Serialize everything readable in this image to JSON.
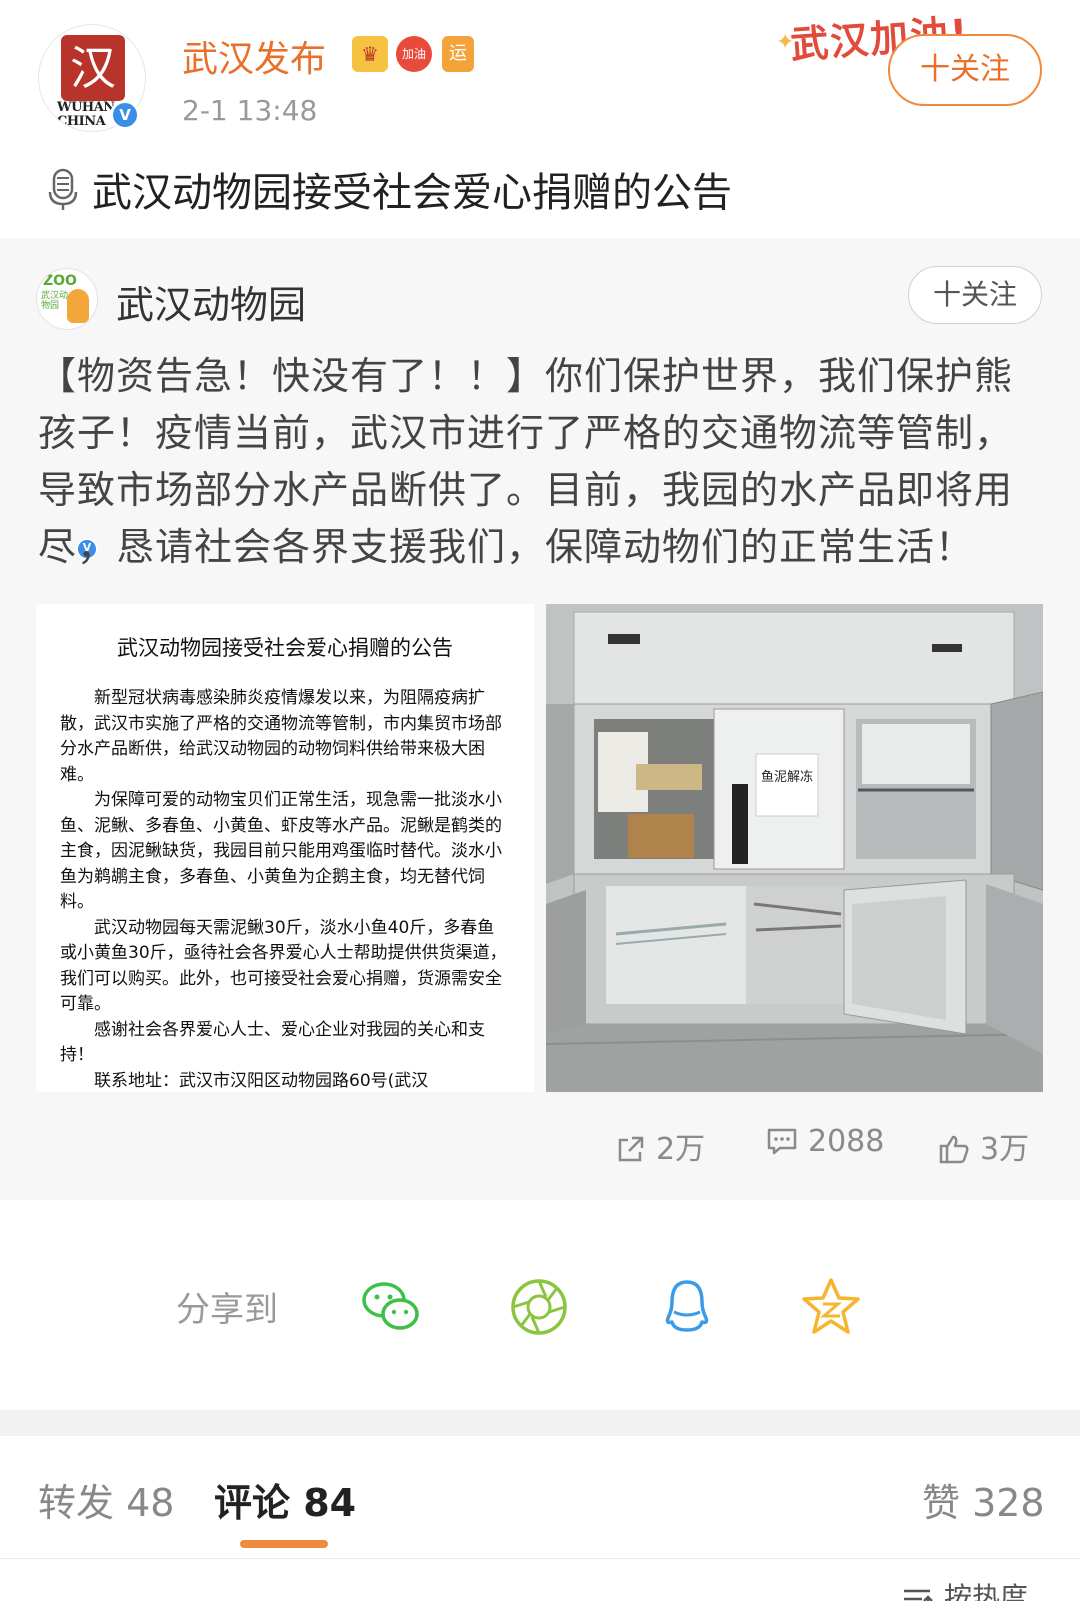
{
  "author": {
    "name": "武汉发布",
    "time": "2-1 13:48",
    "avatar_text": "汉",
    "avatar_en": "WUHAN CHINA",
    "badges": {
      "crown": "♛",
      "heart": "加油",
      "yun": "运"
    },
    "follow_label": "十关注",
    "decoration_text": "武汉加油!"
  },
  "headline": "武汉动物园接受社会爱心捐赠的公告",
  "repost": {
    "author": "武汉动物园",
    "avatar_text": "ZOO",
    "avatar_sub": "武汉动物园",
    "follow_label": "十关注",
    "text": "【物资告急！快没有了！！】你们保护世界，我们保护熊孩子！疫情当前，武汉市进行了严格的交通物流等管制，导致市场部分水产品断供了。目前，我园的水产品即将用尽，恳请社会各界支援我们，保障动物们的正常生活！",
    "notice": {
      "title": "武汉动物园接受社会爱心捐赠的公告",
      "p1": "新型冠状病毒感染肺炎疫情爆发以来，为阻隔疫病扩散，武汉市实施了严格的交通物流等管制，市内集贸市场部分水产品断供，给武汉动物园的动物饲料供给带来极大困难。",
      "p2": "为保障可爱的动物宝贝们正常生活，现急需一批淡水小鱼、泥鳅、多春鱼、小黄鱼、虾皮等水产品。泥鳅是鹤类的主食，因泥鳅缺货，我园目前只能用鸡蛋临时替代。淡水小鱼为鹈鹕主食，多春鱼、小黄鱼为企鹅主食，均无替代饲料。",
      "p3": "武汉动物园每天需泥鳅30斤，淡水小鱼40斤，多春鱼或小黄鱼30斤，亟待社会各界爱心人士帮助提供供货渠道，我们可以购买。此外，也可接受社会爱心捐赠，货源需安全可靠。",
      "p4": "感谢社会各界爱心人士、爱心企业对我园的关心和支持！",
      "p5": "联系地址：武汉市汉阳区动物园路60号(武汉"
    },
    "photo_sign": "鱼泥解冻",
    "stats": {
      "reposts": "2万",
      "comments": "2088",
      "likes": "3万"
    }
  },
  "share": {
    "label": "分享到",
    "targets": [
      "wechat",
      "moments",
      "qq",
      "qzone"
    ]
  },
  "tabs": {
    "repost": "转发 48",
    "comment": "评论 84",
    "like": "赞 328",
    "sort": "按热度"
  },
  "colors": {
    "accent": "#e8702a",
    "follow_border": "#f08a3c",
    "wechat": "#3fbf4a",
    "moments": "#8bc43f",
    "qq": "#3a9be8",
    "qzone": "#f5b52e"
  }
}
